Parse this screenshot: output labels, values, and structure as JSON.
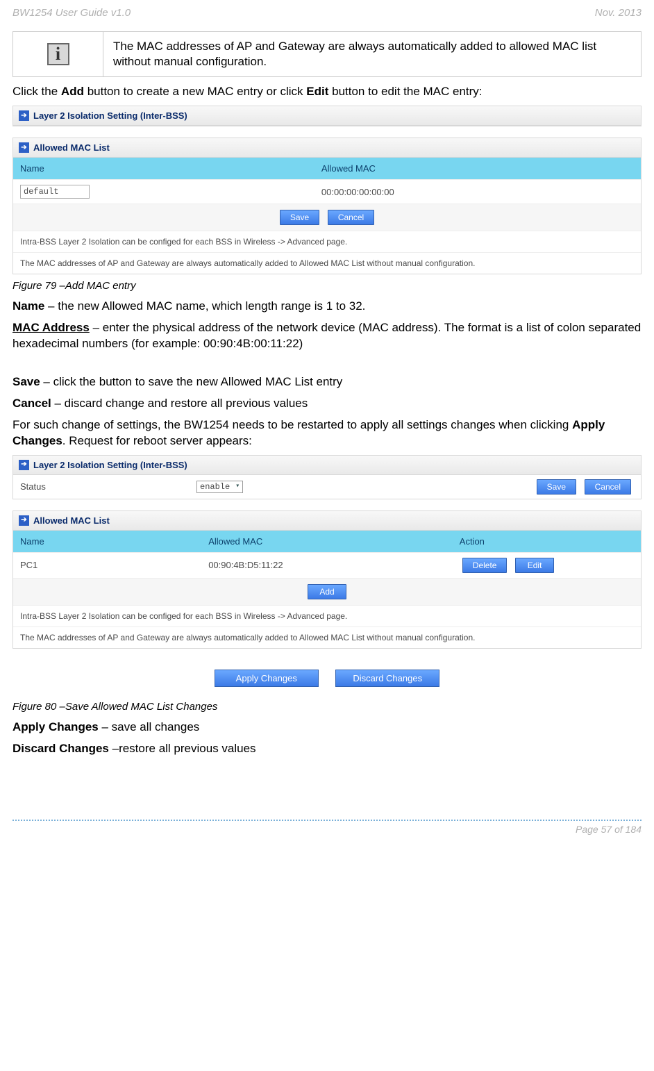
{
  "header_left": "BW1254 User Guide v1.0",
  "header_right": "Nov.  2013",
  "info_box_icon": "i",
  "info_box_text": "The MAC addresses of AP and Gateway are always automatically added to allowed MAC list without manual configuration.",
  "click_add_pre": "Click the ",
  "click_add_b1": "Add",
  "click_add_mid": " button to create a new MAC entry or click ",
  "click_add_b2": "Edit",
  "click_add_post": " button to edit the MAC entry:",
  "panel1": {
    "title": "Layer 2 Isolation Setting (Inter-BSS)",
    "list_title": "Allowed MAC List",
    "head_name": "Name",
    "head_mac": "Allowed MAC",
    "row_name_value": "default",
    "row_mac": "00:00:00:00:00:00",
    "btn_save": "Save",
    "btn_cancel": "Cancel",
    "note1": "Intra-BSS Layer 2 Isolation can be configed for each BSS in Wireless -> Advanced page.",
    "note2": "The MAC addresses of AP and Gateway are always automatically added to Allowed MAC List without manual configuration."
  },
  "fig79": "Figure 79 –Add MAC entry",
  "name_label": "Name",
  "name_desc": " – the new Allowed MAC name, which length range is 1 to 32.",
  "mac_label": "MAC Address",
  "mac_desc": " – enter the physical address of the network device (MAC address). The format is a list of colon separated hexadecimal numbers (for example: 00:90:4B:00:11:22)",
  "save_label": "Save",
  "save_desc": " – click the button to save the new Allowed MAC List entry",
  "cancel_label": "Cancel",
  "cancel_desc": " – discard change and restore all previous values",
  "restart_pre": "For such change of settings, the BW1254 needs to be restarted to apply all settings changes when clicking ",
  "restart_bold": "Apply Changes",
  "restart_post": ". Request for reboot server appears:",
  "panel2": {
    "title": "Layer 2 Isolation Setting (Inter-BSS)",
    "status_label": "Status",
    "status_value": "enable",
    "btn_save": "Save",
    "btn_cancel": "Cancel",
    "list_title": "Allowed MAC List",
    "head_name": "Name",
    "head_mac": "Allowed MAC",
    "head_action": "Action",
    "row_name": "PC1",
    "row_mac": "00:90:4B:D5:11:22",
    "btn_delete": "Delete",
    "btn_edit": "Edit",
    "btn_add": "Add",
    "note1": "Intra-BSS Layer 2 Isolation can be configed for each BSS in Wireless -> Advanced page.",
    "note2": "The MAC addresses of AP and Gateway are always automatically added to Allowed MAC List without manual configuration.",
    "apply_changes": "Apply Changes",
    "discard_changes": "Discard Changes"
  },
  "fig80": "Figure 80 –Save Allowed MAC List Changes",
  "apply_label": "Apply Changes",
  "apply_desc": " – save all changes",
  "discard_label": "Discard Changes",
  "discard_desc": " –restore all previous values",
  "footer": "Page 57 of 184"
}
